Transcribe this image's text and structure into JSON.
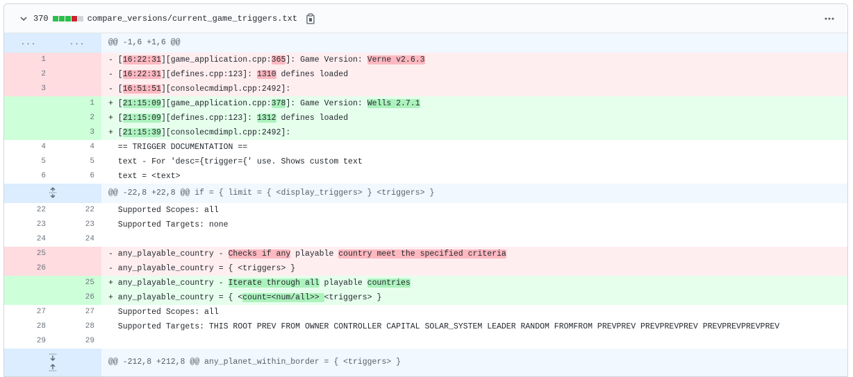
{
  "file": {
    "change_count": "370",
    "name": "compare_versions/current_game_triggers.txt",
    "diffstat_colors": [
      "#2cbe4e",
      "#2cbe4e",
      "#2cbe4e",
      "#cb2431",
      "#d1d5da"
    ]
  },
  "hunks": {
    "first": {
      "left": "...",
      "right": "...",
      "header": "@@ -1,6 +1,6 @@"
    },
    "second": {
      "header": "@@ -22,8 +22,8 @@ if = { limit = { <display_triggers> } <triggers> }"
    },
    "third": {
      "header": "@@ -212,8 +212,8 @@ any_planet_within_border = { <triggers> }"
    }
  },
  "lines": [
    {
      "type": "del",
      "old": "1",
      "new": "",
      "segs": [
        [
          "- [",
          ""
        ],
        [
          "16:22:31",
          "hl"
        ],
        [
          "][game_application.cpp:",
          ""
        ],
        [
          "365",
          "hl"
        ],
        [
          "]: Game Version: ",
          ""
        ],
        [
          "Verne v2.6.3",
          "hl"
        ]
      ]
    },
    {
      "type": "del",
      "old": "2",
      "new": "",
      "segs": [
        [
          "- [",
          ""
        ],
        [
          "16:22:31",
          "hl"
        ],
        [
          "][defines.cpp:123]: ",
          ""
        ],
        [
          "1310",
          "hl"
        ],
        [
          " defines loaded",
          ""
        ]
      ]
    },
    {
      "type": "del",
      "old": "3",
      "new": "",
      "segs": [
        [
          "- [",
          ""
        ],
        [
          "16:51:51",
          "hl"
        ],
        [
          "][consolecmdimpl.cpp:2492]:",
          ""
        ]
      ]
    },
    {
      "type": "add",
      "old": "",
      "new": "1",
      "segs": [
        [
          "+ [",
          ""
        ],
        [
          "21:15:09",
          "hl"
        ],
        [
          "][game_application.cpp:",
          ""
        ],
        [
          "378",
          "hl"
        ],
        [
          "]: Game Version: ",
          ""
        ],
        [
          "Wells 2.7.1",
          "hl"
        ]
      ]
    },
    {
      "type": "add",
      "old": "",
      "new": "2",
      "segs": [
        [
          "+ [",
          ""
        ],
        [
          "21:15:09",
          "hl"
        ],
        [
          "][defines.cpp:123]: ",
          ""
        ],
        [
          "1312",
          "hl"
        ],
        [
          " defines loaded",
          ""
        ]
      ]
    },
    {
      "type": "add",
      "old": "",
      "new": "3",
      "segs": [
        [
          "+ [",
          ""
        ],
        [
          "21:15:39",
          "hl"
        ],
        [
          "][consolecmdimpl.cpp:2492]:",
          ""
        ]
      ]
    },
    {
      "type": "ctx",
      "old": "4",
      "new": "4",
      "segs": [
        [
          "  == TRIGGER DOCUMENTATION ==",
          ""
        ]
      ]
    },
    {
      "type": "ctx",
      "old": "5",
      "new": "5",
      "segs": [
        [
          "  text - For 'desc={trigger={' use. Shows custom text",
          ""
        ]
      ]
    },
    {
      "type": "ctx",
      "old": "6",
      "new": "6",
      "segs": [
        [
          "  text = <text>",
          ""
        ]
      ]
    },
    {
      "type": "hunk2"
    },
    {
      "type": "ctx",
      "old": "22",
      "new": "22",
      "segs": [
        [
          "  Supported Scopes: all",
          ""
        ]
      ]
    },
    {
      "type": "ctx",
      "old": "23",
      "new": "23",
      "segs": [
        [
          "  Supported Targets: none",
          ""
        ]
      ]
    },
    {
      "type": "ctx",
      "old": "24",
      "new": "24",
      "segs": [
        [
          "",
          ""
        ]
      ]
    },
    {
      "type": "del",
      "old": "25",
      "new": "",
      "segs": [
        [
          "- any_playable_country - ",
          ""
        ],
        [
          "Checks if any",
          "hl"
        ],
        [
          " playable ",
          ""
        ],
        [
          "country meet the specified criteria",
          "hl"
        ]
      ]
    },
    {
      "type": "del",
      "old": "26",
      "new": "",
      "segs": [
        [
          "- any_playable_country = { <triggers> }",
          ""
        ]
      ]
    },
    {
      "type": "add",
      "old": "",
      "new": "25",
      "segs": [
        [
          "+ any_playable_country - ",
          ""
        ],
        [
          "Iterate through all",
          "hl"
        ],
        [
          " playable ",
          ""
        ],
        [
          "countries",
          "hl"
        ]
      ]
    },
    {
      "type": "add",
      "old": "",
      "new": "26",
      "segs": [
        [
          "+ any_playable_country = { <",
          ""
        ],
        [
          "count=<num/all>> ",
          "hl"
        ],
        [
          "<triggers> }",
          ""
        ]
      ]
    },
    {
      "type": "ctx",
      "old": "27",
      "new": "27",
      "segs": [
        [
          "  Supported Scopes: all",
          ""
        ]
      ]
    },
    {
      "type": "ctx",
      "old": "28",
      "new": "28",
      "segs": [
        [
          "  Supported Targets: THIS ROOT PREV FROM OWNER CONTROLLER CAPITAL SOLAR_SYSTEM LEADER RANDOM FROMFROM PREVPREV PREVPREVPREV PREVPREVPREVPREV",
          ""
        ]
      ]
    },
    {
      "type": "ctx",
      "old": "29",
      "new": "29",
      "segs": [
        [
          "",
          ""
        ]
      ]
    },
    {
      "type": "hunk3"
    }
  ]
}
